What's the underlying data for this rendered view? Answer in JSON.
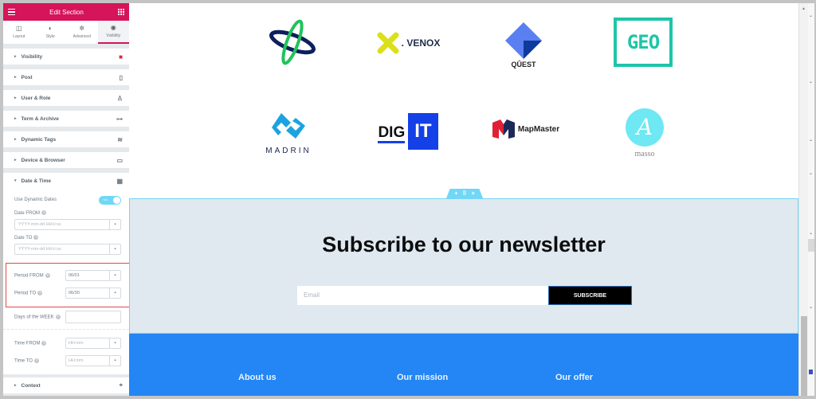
{
  "editor": {
    "title": "Edit Section",
    "tabs": [
      {
        "label": "Layout",
        "icon": "layout-icon"
      },
      {
        "label": "Style",
        "icon": "contrast-icon"
      },
      {
        "label": "Advanced",
        "icon": "gear-icon"
      },
      {
        "label": "Visibility",
        "icon": "eye-icon",
        "active": true
      }
    ],
    "sections": [
      {
        "label": "Visibility",
        "icon": "visibility-toggle-icon"
      },
      {
        "label": "Post",
        "icon": "document-icon"
      },
      {
        "label": "User & Role",
        "icon": "user-icon"
      },
      {
        "label": "Term & Archive",
        "icon": "sitemap-icon"
      },
      {
        "label": "Dynamic Tags",
        "icon": "database-icon"
      },
      {
        "label": "Device & Browser",
        "icon": "mobile-icon"
      },
      {
        "label": "Date & Time",
        "icon": "calendar-icon",
        "expanded": true
      }
    ],
    "date_time": {
      "use_dynamic_dates_label": "Use Dynamic Dates",
      "use_dynamic_dates_toggle": "YES",
      "date_from_label": "Date FROM",
      "date_from_placeholder": "YYYY-mm-dd HH:ii:ss",
      "date_to_label": "Date TO",
      "date_to_placeholder": "YYYY-mm-dd HH:ii:ss",
      "period_from_label": "Period FROM",
      "period_from_value": "06/01",
      "period_to_label": "Period TO",
      "period_to_value": "06/30",
      "days_of_week_label": "Days of the WEEK",
      "days_of_week_value": "",
      "time_from_label": "Time FROM",
      "time_from_placeholder": "HH:mm",
      "time_to_label": "Time TO",
      "time_to_placeholder": "HH:mm"
    },
    "context_section": {
      "label": "Context",
      "icon": "crosshair-icon"
    },
    "help_glyph": "?",
    "caret_right": "▸",
    "caret_down": "▾",
    "delete_glyph": "🗑",
    "collapse_glyph": "‹"
  },
  "canvas": {
    "logos": [
      {
        "name": "orbit-logo",
        "text": ""
      },
      {
        "name": "venox-logo",
        "text": ". VENOX"
      },
      {
        "name": "quest-logo",
        "text": "QŪEST"
      },
      {
        "name": "geo-logo",
        "text": "GEO"
      },
      {
        "name": "madrin-logo",
        "text": "MADRIN"
      },
      {
        "name": "digit-logo",
        "text_a": "DIG",
        "text_b": "IT"
      },
      {
        "name": "mapmaster-logo",
        "text": "MapMaster"
      },
      {
        "name": "masso-logo",
        "text": "masso"
      }
    ],
    "section_handle": {
      "add": "+",
      "move": "⠿",
      "close": "×"
    },
    "newsletter": {
      "title": "Subscribe to our newsletter",
      "email_placeholder": "Email",
      "button_label": "SUBSCRIBE"
    },
    "footer": {
      "links": [
        "About us",
        "Our mission",
        "Our offer"
      ]
    }
  },
  "colors": {
    "editor_accent": "#d5145a",
    "section_outline": "#71d7f7",
    "footer_bg": "#2386f4",
    "newsletter_bg": "#e0e9ef",
    "highlight_border": "#e04848"
  }
}
